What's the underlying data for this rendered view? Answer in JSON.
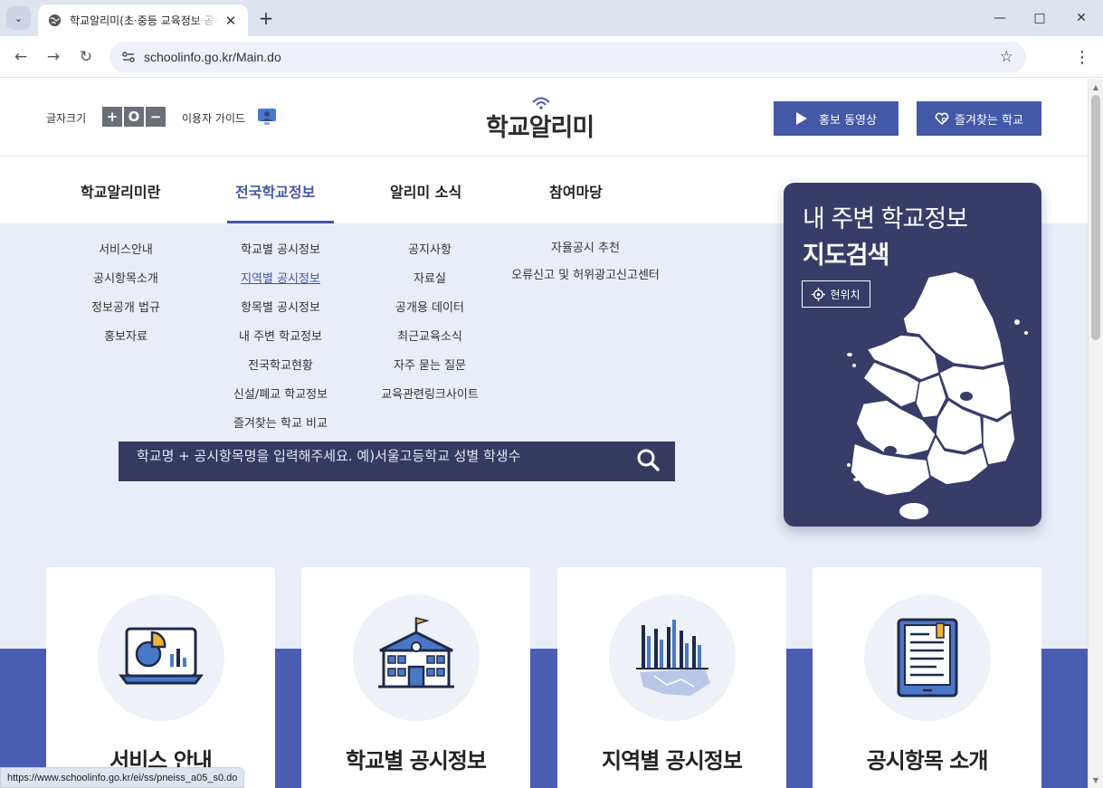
{
  "browser": {
    "tab_title": "학교알리미(초·중등 교육정보 공시서비스)",
    "url": "schoolinfo.go.kr/Main.do",
    "status_url": "https://www.schoolinfo.go.kr/ei/ss/pneiss_a05_s0.do"
  },
  "header": {
    "font_size_label": "글자크기",
    "font_controls": [
      "+",
      "O",
      "−"
    ],
    "guide_label": "이용자 가이드",
    "logo_text": "학교알리미",
    "video_button": "홍보 동영상",
    "favorite_button": "즐겨찾는 학교"
  },
  "gnb": [
    {
      "label": "학교알리미란"
    },
    {
      "label": "전국학교정보"
    },
    {
      "label": "알리미 소식"
    },
    {
      "label": "참여마당"
    }
  ],
  "dropdown": {
    "col1": [
      "서비스안내",
      "공시항목소개",
      "정보공개 법규",
      "홍보자료"
    ],
    "col2": [
      "학교별 공시정보",
      "지역별 공시정보",
      "항목별 공시정보",
      "내 주변 학교정보",
      "전국학교현황",
      "신설/폐교 학교정보",
      "즐겨찾는 학교 비교"
    ],
    "col3": [
      "공지사항",
      "자료실",
      "공개용 데이터",
      "최근교육소식",
      "자주 묻는 질문",
      "교육관련링크사이트"
    ],
    "col4": [
      "자율공시 추천",
      "오류신고 및 허위광고신고센터"
    ]
  },
  "search": {
    "placeholder": "학교명 + 공시항목명을 입력해주세요. 예)서울고등학교 성별 학생수"
  },
  "map_card": {
    "title_line1": "내 주변 학교정보",
    "title_line2": "지도검색",
    "location_button": "현위치"
  },
  "cards": [
    {
      "title": "서비스 안내",
      "icon": "monitor-chart-icon"
    },
    {
      "title": "학교별 공시정보",
      "icon": "school-building-icon"
    },
    {
      "title": "지역별 공시정보",
      "icon": "regional-bar-chart-icon"
    },
    {
      "title": "공시항목 소개",
      "icon": "document-tablet-icon"
    }
  ],
  "colors": {
    "primary": "#4458a8",
    "navy": "#343a60",
    "map_card": "#373d69",
    "light_bg": "#e8edf8",
    "band": "#4b5cb3"
  }
}
